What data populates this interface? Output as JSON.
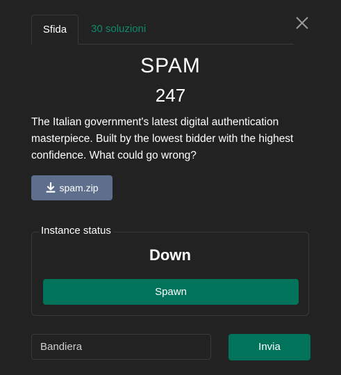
{
  "tabs": {
    "challenge_label": "Sfida",
    "solves_label": "30 soluzioni"
  },
  "challenge": {
    "name": "SPAM",
    "points": "247",
    "description": "The Italian government's latest digital authentication masterpiece. Built by the lowest bidder with the highest confidence. What could go wrong?",
    "file_label": "spam.zip",
    "file_icon": "download-icon"
  },
  "instance": {
    "legend": "Instance status",
    "status": "Down",
    "spawn_label": "Spawn"
  },
  "submission": {
    "flag_placeholder": "Bandiera",
    "submit_label": "Invia"
  },
  "close_icon": "close-icon",
  "colors": {
    "background": "#222222",
    "accent_green": "#00735a",
    "tab_link": "#0f8a6a",
    "file_button": "#5d6f8d"
  }
}
